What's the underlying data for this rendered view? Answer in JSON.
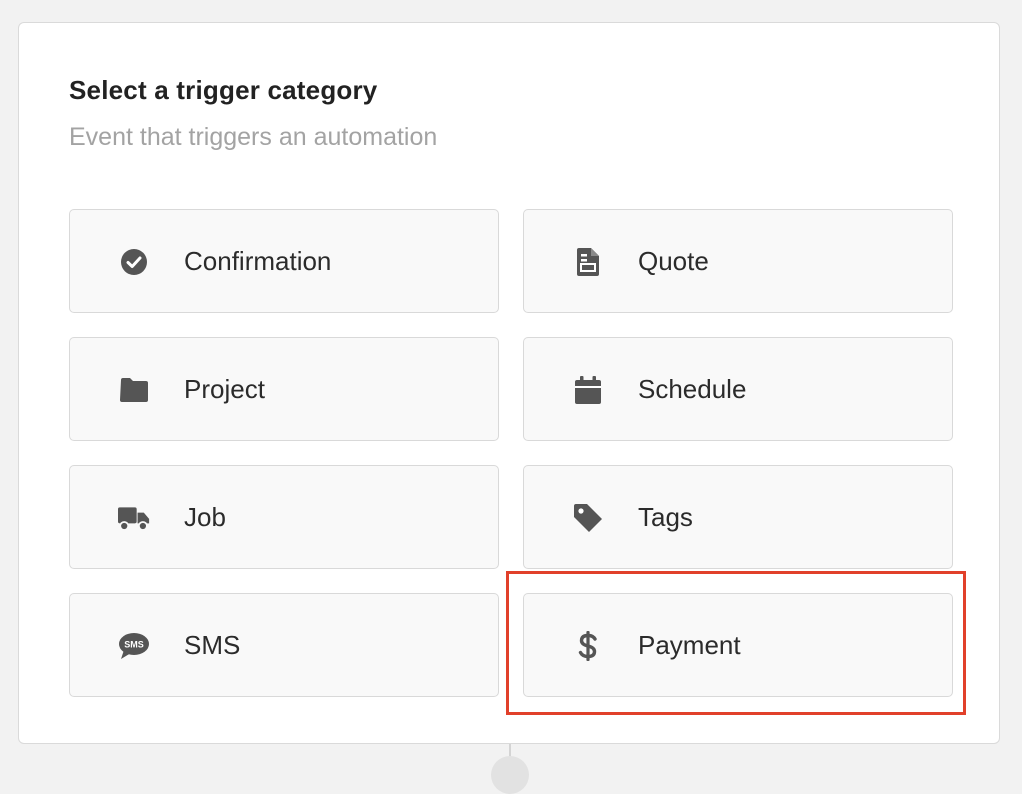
{
  "header": {
    "title": "Select a trigger category",
    "subtitle": "Event that triggers an automation"
  },
  "categories": [
    {
      "label": "Confirmation",
      "icon": "check-circle-icon"
    },
    {
      "label": "Quote",
      "icon": "document-icon"
    },
    {
      "label": "Project",
      "icon": "folder-icon"
    },
    {
      "label": "Schedule",
      "icon": "calendar-icon"
    },
    {
      "label": "Job",
      "icon": "truck-icon"
    },
    {
      "label": "Tags",
      "icon": "tag-icon"
    },
    {
      "label": "SMS",
      "icon": "sms-bubble-icon"
    },
    {
      "label": "Payment",
      "icon": "dollar-icon"
    }
  ],
  "colors": {
    "icon": "#555555",
    "highlight": "#e1402a"
  }
}
